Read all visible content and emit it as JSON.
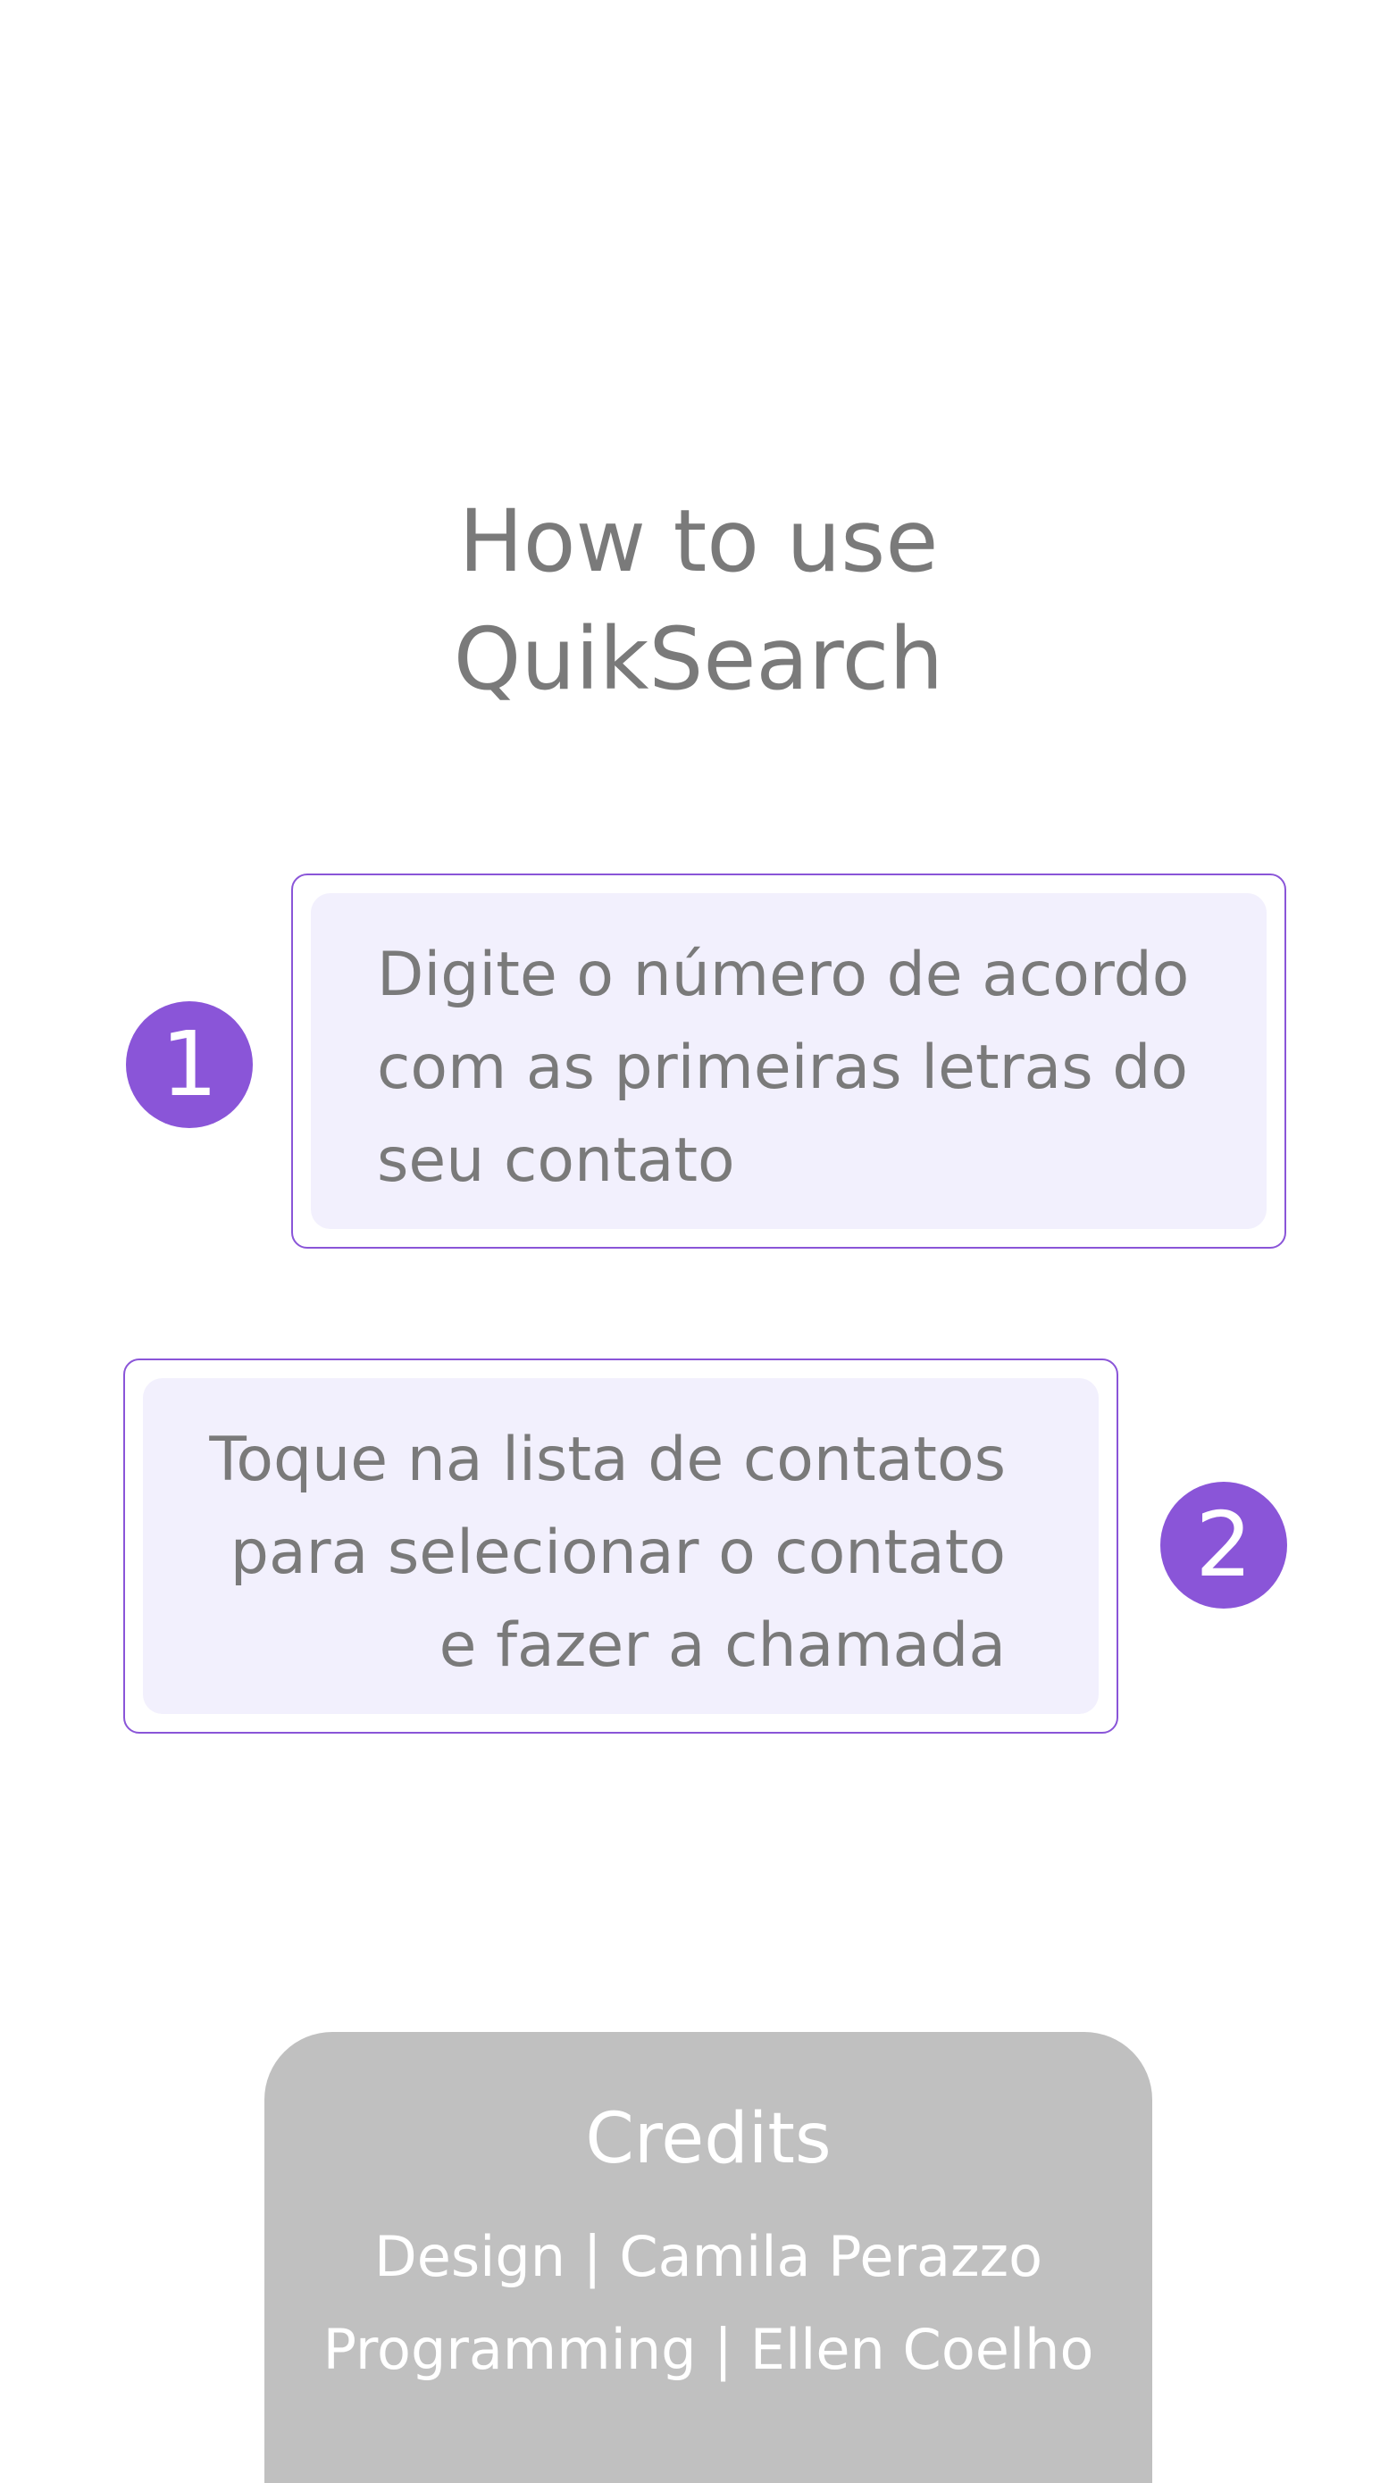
{
  "title": {
    "line1": "How to use",
    "line2": "QuikSearch"
  },
  "steps": [
    {
      "number": "1",
      "lines": [
        "Digite o número de acordo",
        "com as primeiras letras do",
        "seu contato"
      ]
    },
    {
      "number": "2",
      "lines": [
        "Toque na lista de contatos",
        "para selecionar o contato",
        "e fazer a chamada"
      ]
    }
  ],
  "credits": {
    "title": "Credits",
    "design": "Design | Camila Perazzo",
    "programming": "Programming | Ellen Coelho"
  },
  "colors": {
    "accent": "#8a55d8",
    "card_fill": "#f2f0fd",
    "text": "#7a7a7a",
    "credits_bg": "#c0c0c0"
  }
}
